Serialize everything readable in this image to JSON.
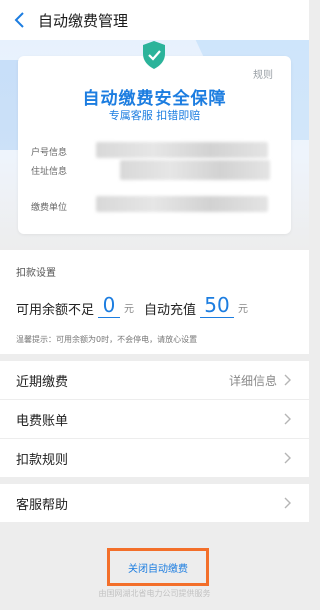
{
  "header": {
    "title": "自动缴费管理"
  },
  "card": {
    "rules_link": "规则",
    "title": "自动缴费安全保障",
    "subtitle": "专属客服 扣错即赔",
    "labels": {
      "account": "户号信息",
      "address": "住址信息",
      "company": "缴费单位"
    }
  },
  "settings": {
    "header": "扣款设置",
    "balance_prefix": "可用余额不足",
    "threshold_value": "0",
    "unit": "元",
    "recharge_prefix": "自动充值",
    "recharge_value": "50",
    "tip": "温馨提示：可用余额为0时，不会停电，请放心设置"
  },
  "menu": {
    "recent_label": "近期缴费",
    "recent_detail": "详细信息",
    "bill_label": "电费账单",
    "rules_label": "扣款规则",
    "help_label": "客服帮助"
  },
  "close_button": "关闭自动缴费",
  "footer": "由国网湖北省电力公司提供服务",
  "colors": {
    "accent": "#1c7de0",
    "badge": "#2bb39a",
    "highlight_border": "#f36f2a"
  }
}
